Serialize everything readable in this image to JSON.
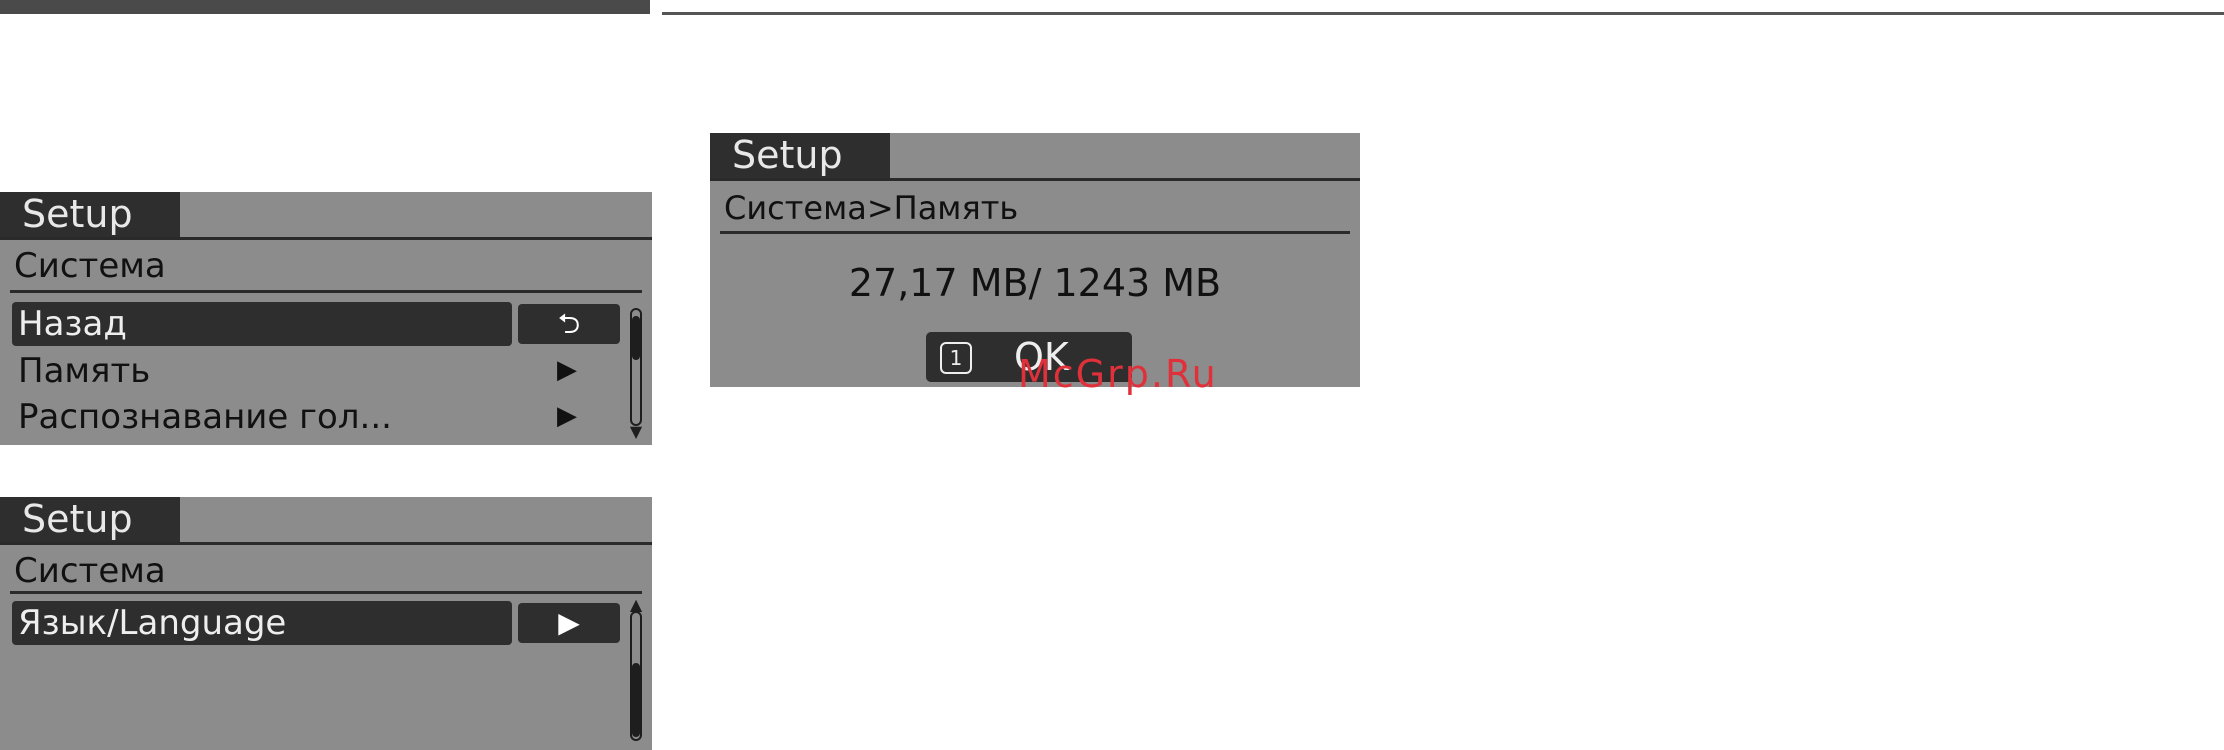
{
  "screen1": {
    "tab": "Setup",
    "section": "Система",
    "items": [
      {
        "label": "Назад",
        "icon": "back-arrow-icon",
        "glyph": "⮌"
      },
      {
        "label": "Память",
        "icon": "chevron-right-icon",
        "glyph": "▶"
      },
      {
        "label": "Распознавание гол...",
        "icon": "chevron-right-icon",
        "glyph": "▶"
      }
    ]
  },
  "screen2": {
    "tab": "Setup",
    "section": "Система",
    "items": [
      {
        "label": "Язык/Language",
        "icon": "chevron-right-icon",
        "glyph": "▶"
      }
    ]
  },
  "screen3": {
    "tab": "Setup",
    "section": "Система>Память",
    "usage": "27,17 MB/ 1243 MB",
    "ok_number": "1",
    "ok_label": "OK"
  },
  "watermark": "McGrp.Ru",
  "colors": {
    "screen_bg": "#8c8c8c",
    "selected_bg": "#2e2e2e",
    "watermark": "#e0303a"
  }
}
